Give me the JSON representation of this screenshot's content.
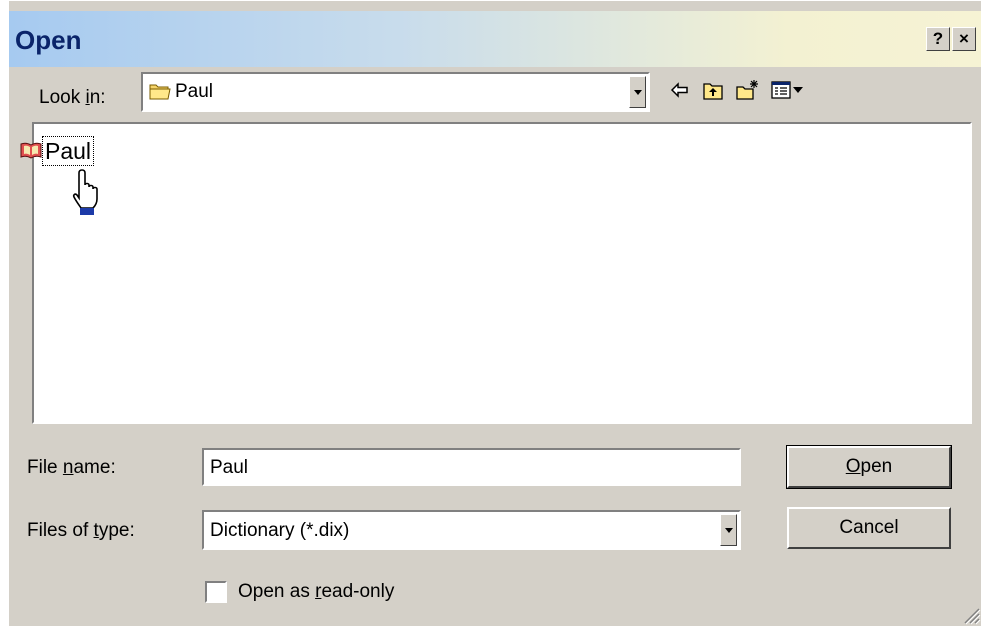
{
  "window": {
    "title": "Open",
    "help_button": "?",
    "close_button": "×"
  },
  "look_in": {
    "label_pre": "Look ",
    "label_accel": "i",
    "label_post": "n:",
    "value": "Paul",
    "icon": "folder-icon"
  },
  "toolbar": {
    "icons": [
      "back-arrow-icon",
      "up-one-level-icon",
      "create-new-folder-icon",
      "view-menu-icon"
    ]
  },
  "file_list": {
    "items": [
      {
        "label": "Paul",
        "icon": "dictionary-book-icon",
        "selected": true
      }
    ],
    "cursor": "hand-pointer-icon"
  },
  "file_name": {
    "label_pre": "File ",
    "label_accel": "n",
    "label_post": "ame:",
    "value": "Paul"
  },
  "file_type": {
    "label_pre": "Files of ",
    "label_accel": "t",
    "label_post": "ype:",
    "value": "Dictionary (*.dix)"
  },
  "buttons": {
    "open_accel": "O",
    "open_rest": "pen",
    "cancel": "Cancel"
  },
  "read_only": {
    "label_pre": "Open as ",
    "label_accel": "r",
    "label_post": "ead-only",
    "checked": false
  },
  "colors": {
    "title_text": "#0a246a",
    "dialog_face": "#d4d0c8",
    "title_gradient_start": "#a6caf0",
    "title_gradient_end": "#f6f3d4"
  }
}
